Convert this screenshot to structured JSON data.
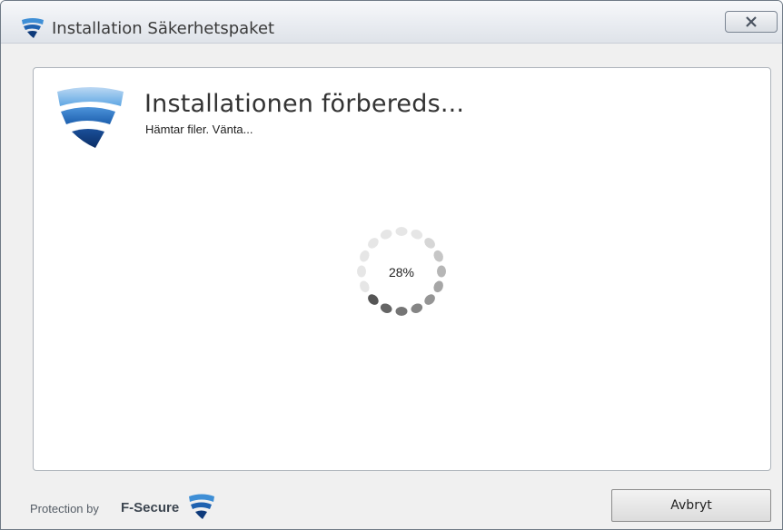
{
  "window": {
    "title": "Installation Säkerhetspaket",
    "close_label": ""
  },
  "main": {
    "heading": "Installationen förbereds...",
    "status": "Hämtar filer. Vänta...",
    "progress": {
      "percent_label": "28%",
      "fraction": 0.28
    }
  },
  "footer": {
    "protection_label": "Protection by",
    "brand_name": "F-Secure",
    "cancel_label": "Avbryt"
  },
  "colors": {
    "brand_blue": "#0e3a7a",
    "brand_light_blue": "#3f8fd6",
    "spinner_dark": "#555555",
    "spinner_light": "#e6e6e6"
  },
  "icons": {
    "title": "fsecure-logo-icon",
    "close": "close-x-icon",
    "spinner": "loading-spinner-icon"
  }
}
